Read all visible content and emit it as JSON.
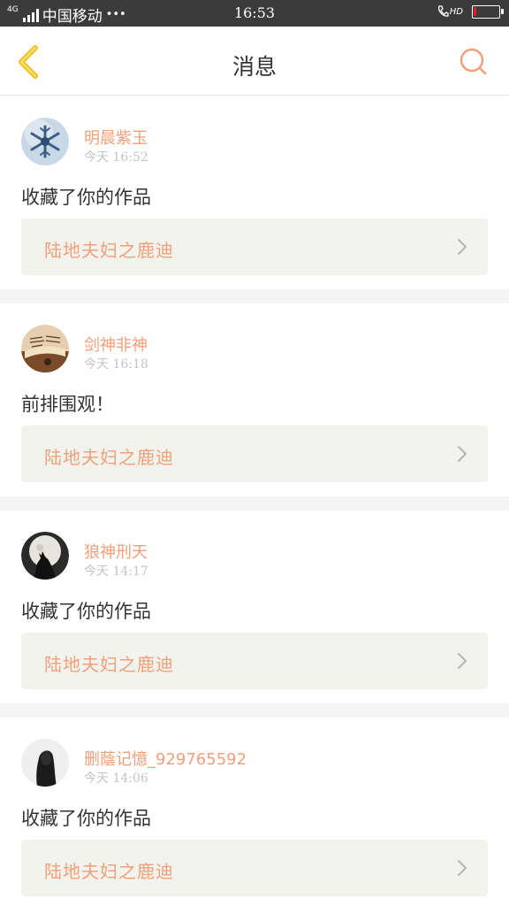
{
  "status_bar": {
    "network_type": "4G",
    "carrier": "中国移动",
    "more": "•••",
    "time": "16:53",
    "hd": "HD",
    "battery_level": 0.12,
    "battery_color": "#e02020"
  },
  "header": {
    "title": "消息",
    "back_icon": "chevron-left-icon",
    "search_icon": "search-icon",
    "accent_color": "#f0a07a",
    "back_color": "#f2c21b"
  },
  "notifications": [
    {
      "username": "明晨紫玉",
      "time": "今天 16:52",
      "message": "收藏了你的作品",
      "work_title": "陆地夫妇之鹿迪",
      "avatar": "snowflake-avatar"
    },
    {
      "username": "剑神非神",
      "time": "今天 16:18",
      "message": "前排围观！",
      "work_title": "陆地夫妇之鹿迪",
      "avatar": "book-avatar"
    },
    {
      "username": "狼神刑天",
      "time": "今天 14:17",
      "message": "收藏了你的作品",
      "work_title": "陆地夫妇之鹿迪",
      "avatar": "wolf-moon-avatar"
    },
    {
      "username": "删蔭记憶_929765592",
      "time": "今天 14:06",
      "message": "收藏了你的作品",
      "work_title": "陆地夫妇之鹿迪",
      "avatar": "girl-silhouette-avatar"
    }
  ]
}
